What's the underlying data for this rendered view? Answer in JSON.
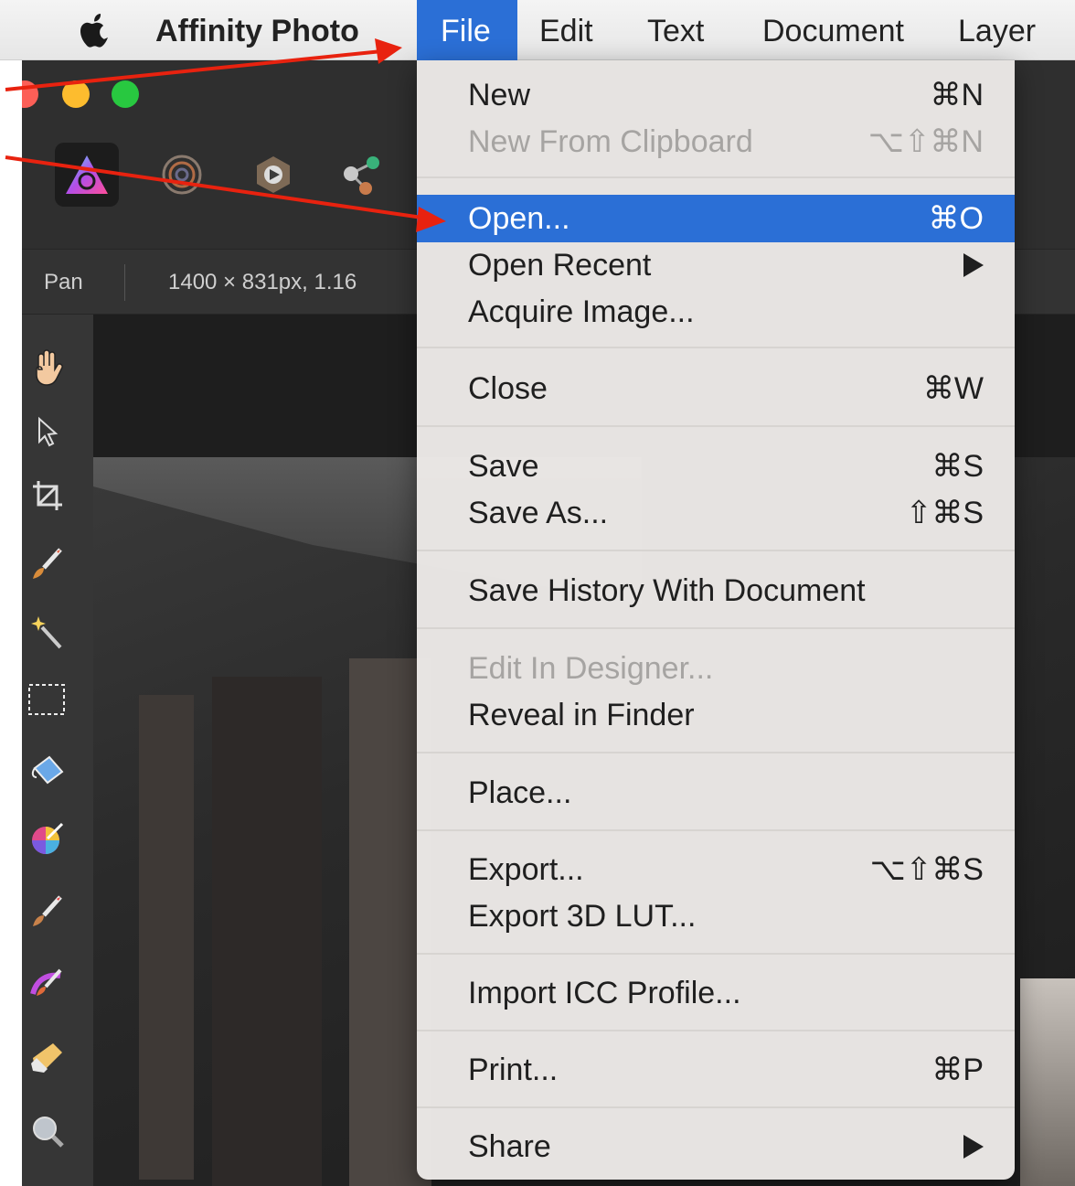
{
  "menubar": {
    "app_name": "Affinity Photo",
    "menus": [
      "File",
      "Edit",
      "Text",
      "Document",
      "Layer"
    ],
    "active_menu": "File"
  },
  "context_toolbar": {
    "tool_name": "Pan",
    "document_info": "1400 × 831px, 1.16"
  },
  "file_menu": {
    "items": [
      {
        "label": "New",
        "shortcut": "⌘N"
      },
      {
        "label": "New From Clipboard",
        "shortcut": "⌥⇧⌘N",
        "disabled": true
      },
      {
        "label": "Open...",
        "shortcut": "⌘O",
        "highlighted": true
      },
      {
        "label": "Open Recent",
        "submenu": true
      },
      {
        "label": "Acquire Image..."
      },
      {
        "label": "Close",
        "shortcut": "⌘W"
      },
      {
        "label": "Save",
        "shortcut": "⌘S"
      },
      {
        "label": "Save As...",
        "shortcut": "⇧⌘S"
      },
      {
        "label": "Save History With Document"
      },
      {
        "label": "Edit In Designer...",
        "disabled": true
      },
      {
        "label": "Reveal in Finder"
      },
      {
        "label": "Place..."
      },
      {
        "label": "Export...",
        "shortcut": "⌥⇧⌘S"
      },
      {
        "label": "Export 3D LUT..."
      },
      {
        "label": "Import ICC Profile..."
      },
      {
        "label": "Print...",
        "shortcut": "⌘P"
      },
      {
        "label": "Share",
        "submenu": true
      }
    ]
  },
  "colors": {
    "menu_highlight": "#2b6fd6",
    "annotation_arrow": "#e8220f",
    "traffic_close": "#fc5f57",
    "traffic_minimize": "#fdbc2e",
    "traffic_zoom": "#28c840"
  },
  "icons": {
    "apple": "apple-logo-icon",
    "personas": [
      "photo-persona-icon",
      "liquify-persona-icon",
      "develop-persona-icon",
      "export-persona-icon"
    ],
    "tools": [
      "hand-tool-icon",
      "move-tool-icon",
      "crop-tool-icon",
      "paint-brush-icon",
      "magic-wand-icon",
      "marquee-selection-icon",
      "flood-fill-icon",
      "color-picker-icon",
      "brush-tool-icon",
      "selection-brush-icon",
      "eraser-icon",
      "zoom-tool-icon"
    ]
  }
}
